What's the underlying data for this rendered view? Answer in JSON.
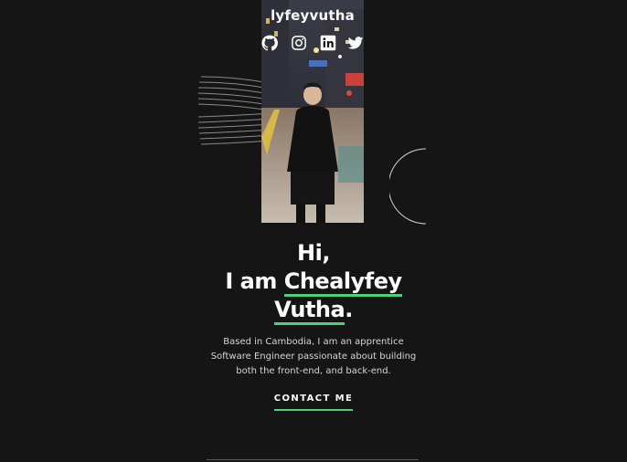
{
  "header": {
    "brand": "lyfeyvutha"
  },
  "socials": [
    {
      "icon": "github-icon",
      "label": "GitHub"
    },
    {
      "icon": "instagram-icon",
      "label": "Instagram"
    },
    {
      "icon": "linkedin-icon",
      "label": "LinkedIn"
    },
    {
      "icon": "twitter-icon",
      "label": "Twitter"
    }
  ],
  "hero": {
    "greeting": "Hi,",
    "lead": "I am",
    "name_first": "Chealyfey",
    "name_last": "Vutha",
    "name_end": ".",
    "intro_line_1": "Based in Cambodia, I am an apprentice",
    "intro_line_2": "Software Engineer passionate about building",
    "intro_line_3": "both the front-end, and back-end.",
    "cta": "CONTACT ME"
  },
  "colors": {
    "background": "#151515",
    "accent": "#4ecf7d",
    "text": "#ffffff"
  }
}
